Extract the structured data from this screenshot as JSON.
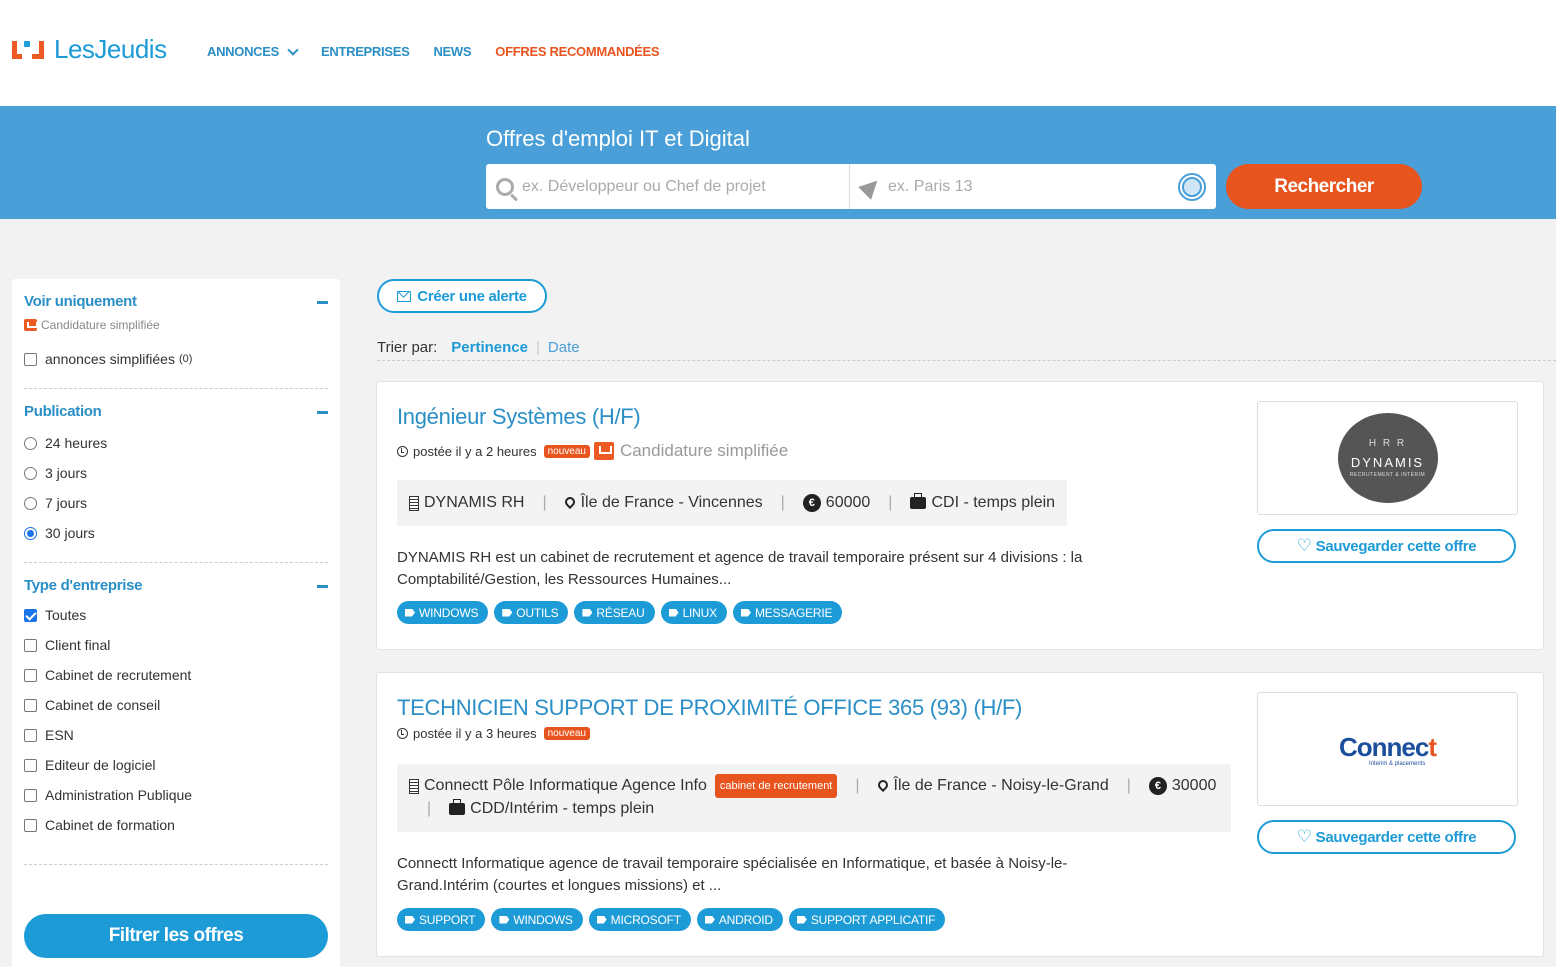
{
  "brand": {
    "name": "LesJeudis"
  },
  "nav": {
    "items": [
      {
        "label": "ANNONCES"
      },
      {
        "label": "ENTREPRISES"
      },
      {
        "label": "NEWS"
      },
      {
        "label": "OFFRES RECOMMANDÉES"
      }
    ]
  },
  "hero": {
    "title": "Offres d'emploi IT et Digital",
    "search_placeholder": "ex. Développeur ou Chef de projet",
    "location_placeholder": "ex. Paris 13",
    "search_button": "Rechercher"
  },
  "sidebar": {
    "voir": {
      "title": "Voir uniquement",
      "note": "Candidature simplifiée",
      "options": [
        {
          "label": "annonces simplifiées",
          "count": "(0)",
          "checked": false
        }
      ]
    },
    "publication": {
      "title": "Publication",
      "options": [
        {
          "label": "24 heures",
          "checked": false
        },
        {
          "label": "3 jours",
          "checked": false
        },
        {
          "label": "7 jours",
          "checked": false
        },
        {
          "label": "30 jours",
          "checked": true
        }
      ]
    },
    "type": {
      "title": "Type d'entreprise",
      "options": [
        {
          "label": "Toutes",
          "checked": true
        },
        {
          "label": "Client final",
          "checked": false
        },
        {
          "label": "Cabinet de recrutement",
          "checked": false
        },
        {
          "label": "Cabinet de conseil",
          "checked": false
        },
        {
          "label": "ESN",
          "checked": false
        },
        {
          "label": "Editeur de logiciel",
          "checked": false
        },
        {
          "label": "Administration Publique",
          "checked": false
        },
        {
          "label": "Cabinet de formation",
          "checked": false
        }
      ]
    },
    "filter_button": "Filtrer les offres"
  },
  "main": {
    "alert_button": "Créer une alerte",
    "sort": {
      "label": "Trier par:",
      "active": "Pertinence",
      "other": "Date"
    },
    "jobs": [
      {
        "title": "Ingénieur Systèmes (H/F)",
        "posted": "postée il y a 2 heures",
        "badge": "nouveau",
        "simplified": "Candidature simplifiée",
        "company": "DYNAMIS RH",
        "location": "Île de France - Vincennes",
        "salary": "60000",
        "contract": "CDI - temps plein",
        "description": "DYNAMIS RH est un cabinet de recrutement et agence de travail temporaire présent sur 4 divisions : la Comptabilité/Gestion, les Ressources Humaines...",
        "tags": [
          "WINDOWS",
          "OUTILS",
          "RÉSEAU",
          "LINUX",
          "MESSAGERIE"
        ],
        "logo": {
          "name": "DYNAMIS",
          "mark": "H R R",
          "sub": "RECRUTEMENT & INTÉRIM"
        },
        "save_button": "Sauvegarder cette offre"
      },
      {
        "title": "TECHNICIEN SUPPORT DE PROXIMITÉ OFFICE 365 (93) (H/F)",
        "posted": "postée il y a 3 heures",
        "badge": "nouveau",
        "company": "Connectt Pôle Informatique Agence Info",
        "company_badge": "cabinet de recrutement",
        "location": "Île de France - Noisy-le-Grand",
        "salary": "30000",
        "contract": "CDD/Intérim - temps plein",
        "description": "Connectt Informatique agence de travail temporaire spécialisée en Informatique, et basée à Noisy-le-Grand.Intérim (courtes et longues missions) et ...",
        "tags": [
          "SUPPORT",
          "WINDOWS",
          "MICROSOFT",
          "ANDROID",
          "SUPPORT APPLICATIF"
        ],
        "logo": {
          "name": "Connec",
          "accent": "t",
          "sub": "Interim & placements"
        },
        "save_button": "Sauvegarder cette offre"
      }
    ]
  }
}
